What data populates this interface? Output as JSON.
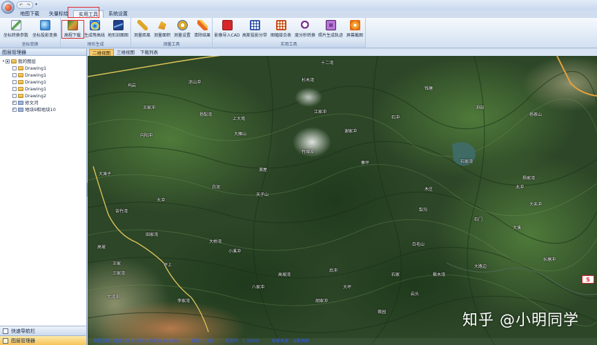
{
  "menu": {
    "tabs": [
      {
        "label": "地图下载"
      },
      {
        "label": "矢量标绘"
      },
      {
        "label": "实用工具"
      },
      {
        "label": "系统设置"
      }
    ]
  },
  "ribbon": {
    "groups": [
      {
        "label": "坐标变换",
        "buttons": [
          {
            "label": "坐标转换参数",
            "icon": "triangle-coordinate-icon"
          },
          {
            "label": "坐标投影变换",
            "icon": "globe-projection-icon"
          }
        ]
      },
      {
        "label": "地形生成",
        "buttons": [
          {
            "label": "高程下载",
            "icon": "terrain-icon"
          },
          {
            "label": "生成等高线",
            "icon": "contour-icon"
          },
          {
            "label": "地形剖面图",
            "icon": "profile-icon"
          }
        ]
      },
      {
        "label": "测量工具",
        "buttons": [
          {
            "label": "测量距离",
            "icon": "ruler-icon"
          },
          {
            "label": "测量面积",
            "icon": "area-icon"
          },
          {
            "label": "测量设置",
            "icon": "measure-settings-icon"
          },
          {
            "label": "清除结果",
            "icon": "clear-icon"
          }
        ]
      },
      {
        "label": "实用工具",
        "buttons": [
          {
            "label": "影像导入CAD",
            "icon": "cad-icon"
          },
          {
            "label": "高斯投影分带",
            "icon": "gauss-zone-icon"
          },
          {
            "label": "图幅接合表",
            "icon": "sheet-table-icon"
          },
          {
            "label": "度分秒转换",
            "icon": "dms-icon"
          },
          {
            "label": "照片生成轨迹",
            "icon": "camera-icon"
          },
          {
            "label": "屏幕截图",
            "icon": "screenshot-icon"
          }
        ]
      }
    ]
  },
  "layer_panel": {
    "title": "图层管理器",
    "tree": [
      {
        "label": "我的图层",
        "level": 0,
        "state": "partial",
        "expanded": true
      },
      {
        "label": "Drawing1",
        "level": 1,
        "state": "unchecked"
      },
      {
        "label": "Drawing1",
        "level": 1,
        "state": "unchecked"
      },
      {
        "label": "Drawing1",
        "level": 1,
        "state": "unchecked"
      },
      {
        "label": "Drawing1",
        "level": 1,
        "state": "unchecked"
      },
      {
        "label": "Drawing2",
        "level": 1,
        "state": "unchecked"
      },
      {
        "label": "修文河",
        "level": 1,
        "state": "checked"
      },
      {
        "label": "地块9和地块10",
        "level": 1,
        "state": "checked"
      }
    ],
    "quick_nav": "快速导航栏",
    "layer_manager_tab": "图层管理器"
  },
  "view_tabs": [
    {
      "label": "二维视图",
      "active": true
    },
    {
      "label": "三维视图",
      "active": false
    },
    {
      "label": "下载列表",
      "active": false
    }
  ],
  "map": {
    "place_labels": [
      "十二湾",
      "杉木湾",
      "钱塘",
      "凉山冲",
      "坞岩",
      "王家冲",
      "杨梨湾",
      "上大塆",
      "江家冲",
      "石冲",
      "冲田",
      "杨茶山",
      "向阳冲",
      "大雁山",
      "谢家冲",
      "白泥",
      "竹垭冲",
      "石家湾",
      "寨坪",
      "苦竹湾",
      "滚屋",
      "杨家湾",
      "太冲",
      "大冲",
      "木庄",
      "大滩子",
      "天子山",
      "大禾冲",
      "梨沟",
      "石门",
      "田家湾",
      "大桥湾",
      "小溪冲",
      "白毛山",
      "大溪",
      "长塘冲",
      "高坡",
      "王家",
      "三家湾",
      "坪上",
      "八家冲",
      "高坡湾",
      "后冲",
      "石家",
      "岩头",
      "大路边",
      "李家湾",
      "胡家冲",
      "茶园",
      "枫木湾",
      "大坪",
      "大湾冲"
    ],
    "status": {
      "coords": "当前坐标：经度106.735655 纬度26.801385",
      "level": "级别：14级",
      "source": "影像来源：谷歌地图",
      "scale": "比例尺：1:36000"
    },
    "watermark": "知乎 @小明同学",
    "sogou_badge": "S"
  }
}
